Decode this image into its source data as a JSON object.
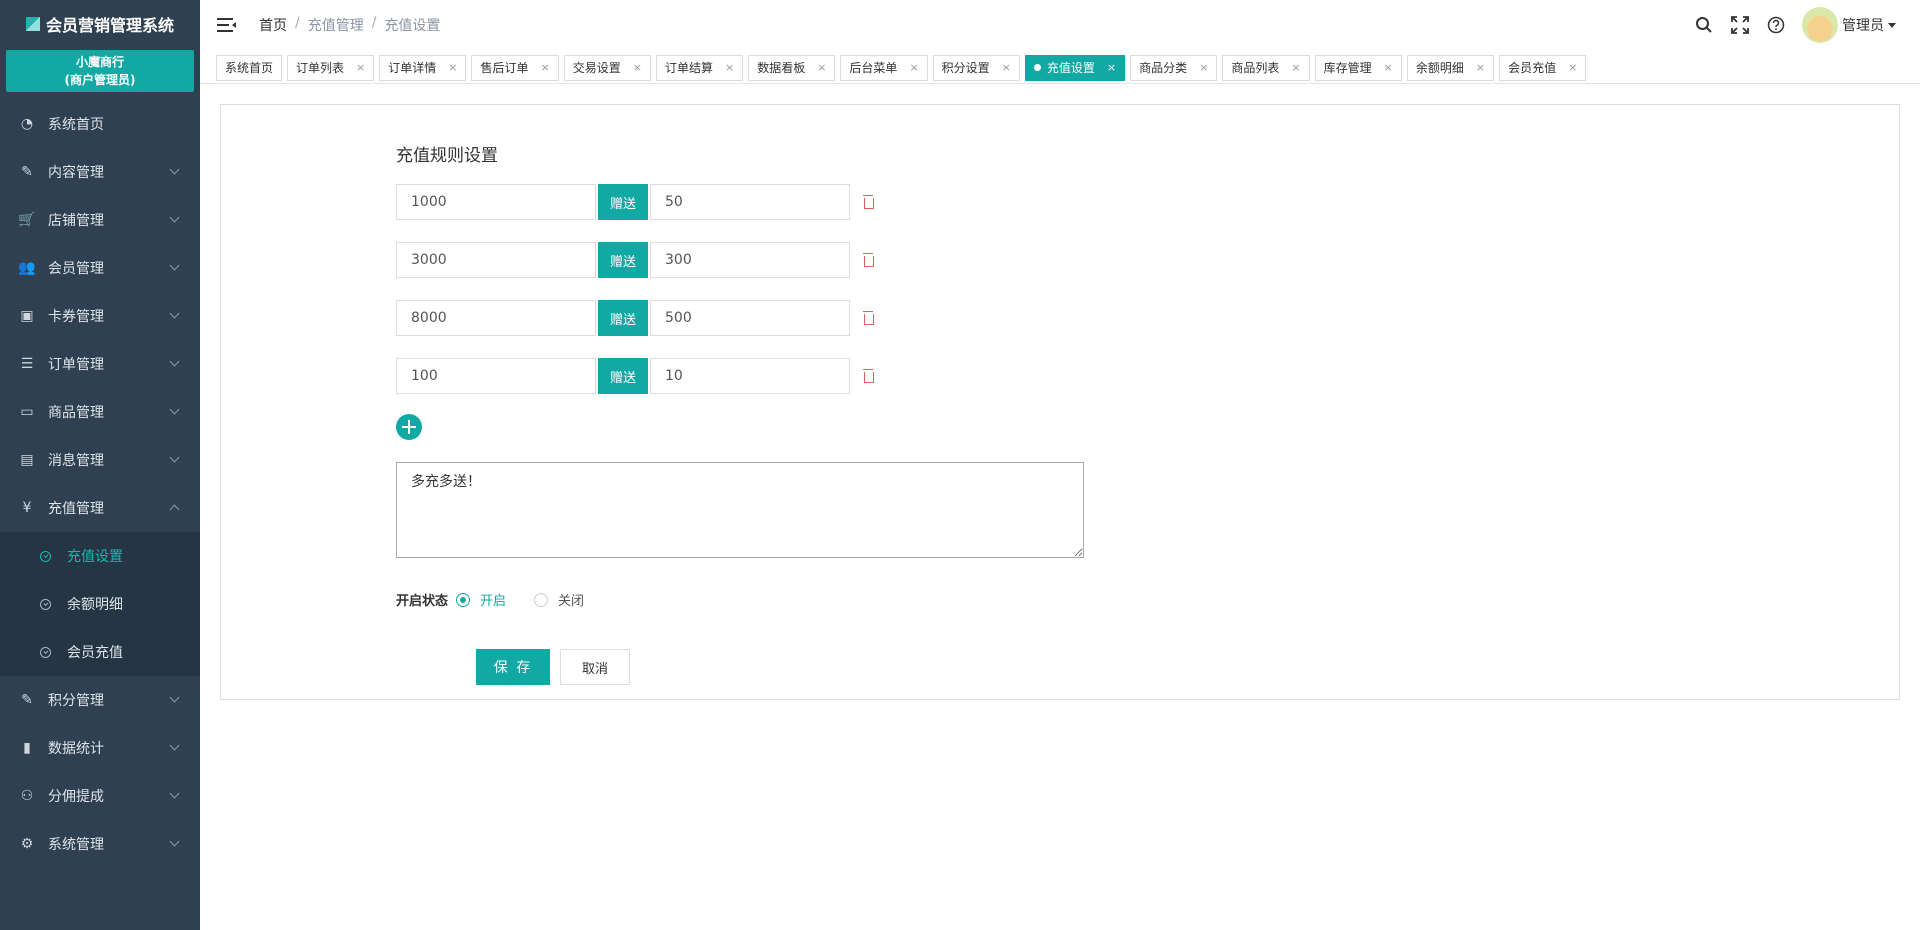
{
  "app": {
    "title": "会员营销管理系统"
  },
  "shop": {
    "name": "小魔商行",
    "role": "(商户管理员)"
  },
  "sidebar": {
    "items": [
      {
        "label": "系统首页",
        "icon": "dashboard-icon",
        "glyph": "◔"
      },
      {
        "label": "内容管理",
        "icon": "edit-icon",
        "glyph": "✎"
      },
      {
        "label": "店铺管理",
        "icon": "cart-icon",
        "glyph": "🛒"
      },
      {
        "label": "会员管理",
        "icon": "users-icon",
        "glyph": "👥"
      },
      {
        "label": "卡券管理",
        "icon": "card-icon",
        "glyph": "▣"
      },
      {
        "label": "订单管理",
        "icon": "list-icon",
        "glyph": "☰"
      },
      {
        "label": "商品管理",
        "icon": "monitor-icon",
        "glyph": "▭"
      },
      {
        "label": "消息管理",
        "icon": "message-icon",
        "glyph": "▤"
      },
      {
        "label": "充值管理",
        "icon": "yen-icon",
        "glyph": "¥"
      },
      {
        "label": "积分管理",
        "icon": "edit-icon",
        "glyph": "✎"
      },
      {
        "label": "数据统计",
        "icon": "bar-chart-icon",
        "glyph": "▮"
      },
      {
        "label": "分佣提成",
        "icon": "sitemap-icon",
        "glyph": "⚇"
      },
      {
        "label": "系统管理",
        "icon": "gear-icon",
        "glyph": "⚙"
      }
    ],
    "sub": [
      {
        "label": "充值设置"
      },
      {
        "label": "余额明细"
      },
      {
        "label": "会员充值"
      }
    ]
  },
  "breadcrumb": {
    "home": "首页",
    "level1": "充值管理",
    "level2": "充值设置"
  },
  "header": {
    "user": "管理员"
  },
  "tabs": [
    {
      "label": "系统首页"
    },
    {
      "label": "订单列表"
    },
    {
      "label": "订单详情"
    },
    {
      "label": "售后订单"
    },
    {
      "label": "交易设置"
    },
    {
      "label": "订单结算"
    },
    {
      "label": "数据看板"
    },
    {
      "label": "后台菜单"
    },
    {
      "label": "积分设置"
    },
    {
      "label": "充值设置"
    },
    {
      "label": "商品分类"
    },
    {
      "label": "商品列表"
    },
    {
      "label": "库存管理"
    },
    {
      "label": "余额明细"
    },
    {
      "label": "会员充值"
    }
  ],
  "form": {
    "title": "充值规则设置",
    "gift_label": "赠送",
    "rules": [
      {
        "amount": "1000",
        "bonus": "50"
      },
      {
        "amount": "3000",
        "bonus": "300"
      },
      {
        "amount": "8000",
        "bonus": "500"
      },
      {
        "amount": "100",
        "bonus": "10"
      }
    ],
    "note": "多充多送！",
    "status_label": "开启状态",
    "status_on": "开启",
    "status_off": "关闭",
    "save": "保 存",
    "cancel": "取消"
  },
  "colors": {
    "accent": "#12a8a3",
    "sidebar": "#2f4050"
  }
}
